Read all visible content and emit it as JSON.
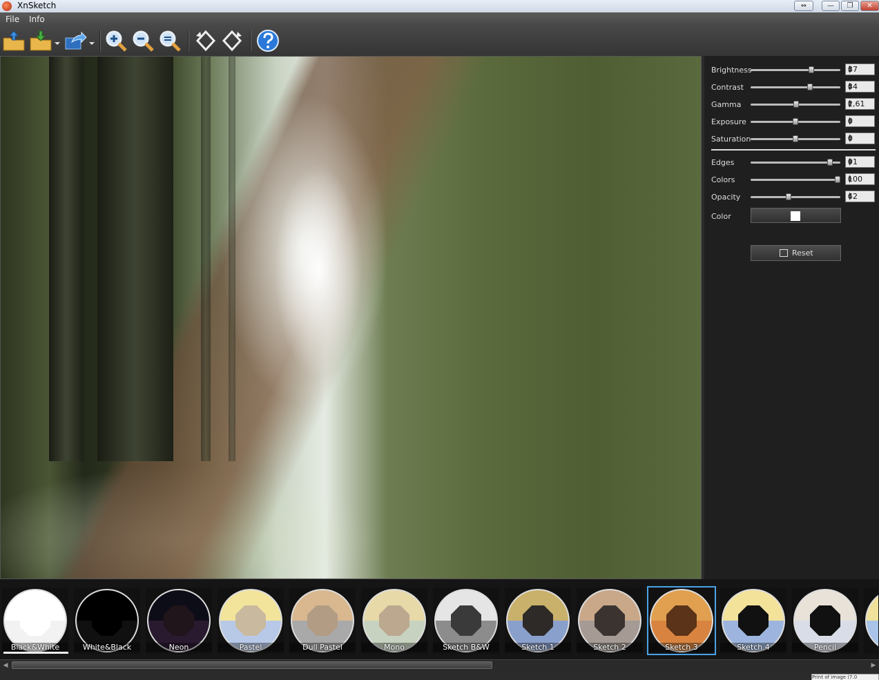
{
  "window": {
    "title": "XnSketch"
  },
  "menu": {
    "file": "File",
    "info": "Info"
  },
  "panel": {
    "sliders_top": [
      {
        "label": "Brightness",
        "value": "37",
        "level": 0.69
      },
      {
        "label": "Contrast",
        "value": "34",
        "level": 0.67
      },
      {
        "label": "Gamma",
        "value": "2,61",
        "level": 0.51
      },
      {
        "label": "Exposure",
        "value": "0",
        "level": 0.5
      },
      {
        "label": "Saturation",
        "value": "0",
        "level": 0.5
      }
    ],
    "sliders_bottom": [
      {
        "label": "Edges",
        "value": "91",
        "level": 0.91
      },
      {
        "label": "Colors",
        "value": "100",
        "level": 1.0
      },
      {
        "label": "Opacity",
        "value": "42",
        "level": 0.42
      }
    ],
    "color_label": "Color",
    "color_value": "#ffffff",
    "reset_label": "Reset"
  },
  "presets": [
    {
      "label": "Black&White",
      "colors": [
        "#f2f2f2",
        "#ffffff"
      ],
      "center": "#ffffff"
    },
    {
      "label": "White&Black",
      "colors": [
        "#101010",
        "#000000"
      ],
      "center": "#000000"
    },
    {
      "label": "Neon",
      "colors": [
        "#2a1a30",
        "#0d0d18"
      ],
      "center": "#20151a"
    },
    {
      "label": "Pastel",
      "colors": [
        "#b8c9e8",
        "#f2e49a"
      ],
      "center": "#c9b99e"
    },
    {
      "label": "Dull Pastel",
      "colors": [
        "#a9a9a9",
        "#d9b88f"
      ],
      "center": "#b39c84"
    },
    {
      "label": "Mono",
      "colors": [
        "#c7d3c0",
        "#e8d9a8"
      ],
      "center": "#bca78f"
    },
    {
      "label": "Sketch B&W",
      "colors": [
        "#8c8c8c",
        "#e5e5e5"
      ],
      "center": "#3a3a3a"
    },
    {
      "label": "Sketch 1",
      "colors": [
        "#8aa0cc",
        "#c9b16b"
      ],
      "center": "#2e2a28"
    },
    {
      "label": "Sketch 2",
      "colors": [
        "#a59b94",
        "#c9a88a"
      ],
      "center": "#3a332f"
    },
    {
      "label": "Sketch 3",
      "colors": [
        "#d88440",
        "#e0a050"
      ],
      "center": "#5a3318"
    },
    {
      "label": "Sketch 4",
      "colors": [
        "#9db5de",
        "#f3e29a"
      ],
      "center": "#111111"
    },
    {
      "label": "Pencil",
      "colors": [
        "#d9dde8",
        "#e8e2d8"
      ],
      "center": "#111111"
    }
  ],
  "accent_color": "#4aa3e8",
  "statusbar": {
    "tab_text": "Print of image (7.0"
  }
}
